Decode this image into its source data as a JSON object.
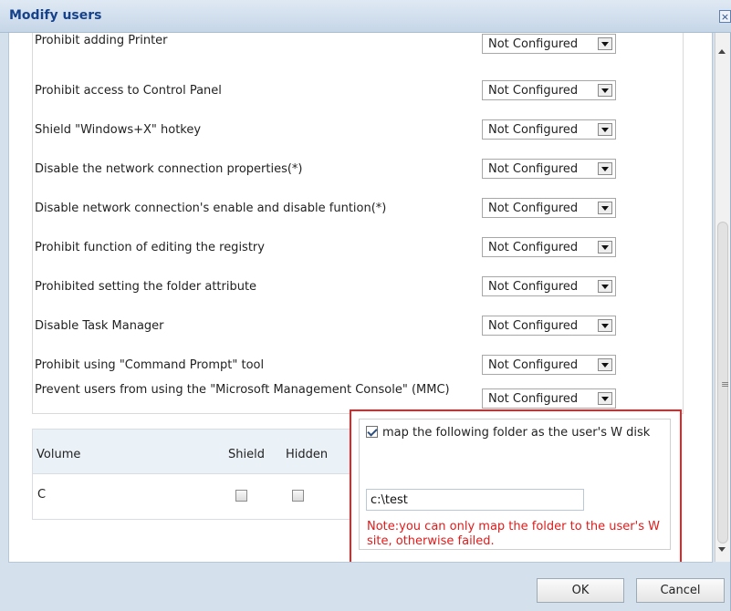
{
  "window": {
    "title": "Modify users",
    "close_icon": "close-icon"
  },
  "policies": [
    {
      "label": "Prohibit adding Printer",
      "value": "Not Configured"
    },
    {
      "label": "Prohibit access to Control Panel",
      "value": "Not Configured"
    },
    {
      "label": "Shield \"Windows+X\" hotkey",
      "value": "Not Configured"
    },
    {
      "label": "Disable the network connection properties(*)",
      "value": "Not Configured"
    },
    {
      "label": "Disable network connection's enable and disable funtion(*)",
      "value": "Not Configured"
    },
    {
      "label": "Prohibit function of editing the registry",
      "value": "Not Configured"
    },
    {
      "label": "Prohibited setting the folder attribute",
      "value": "Not Configured"
    },
    {
      "label": "Disable Task Manager",
      "value": "Not Configured"
    },
    {
      "label": "Prohibit using \"Command Prompt\" tool",
      "value": "Not Configured"
    },
    {
      "label": "Prevent users from using the \"Microsoft Management Console\" (MMC)",
      "value": "Not Configured"
    }
  ],
  "volume_table": {
    "headers": [
      "Volume",
      "Shield",
      "Hidden"
    ],
    "rows": [
      {
        "volume": "C",
        "shield": false,
        "hidden": false
      }
    ]
  },
  "mapping": {
    "checked": true,
    "label": "map the following folder as the user's W disk",
    "path_value": "c:\\test",
    "note": "Note:you can only map the folder to the user's W site, otherwise failed.",
    "note_color": "#e11b1b"
  },
  "buttons": {
    "ok": "OK",
    "cancel": "Cancel"
  },
  "scrollbar": {
    "up_icon": "scroll-up-icon",
    "down_icon": "scroll-down-icon"
  },
  "colors": {
    "title": "#15428b",
    "highlight_border": "#e32525"
  }
}
